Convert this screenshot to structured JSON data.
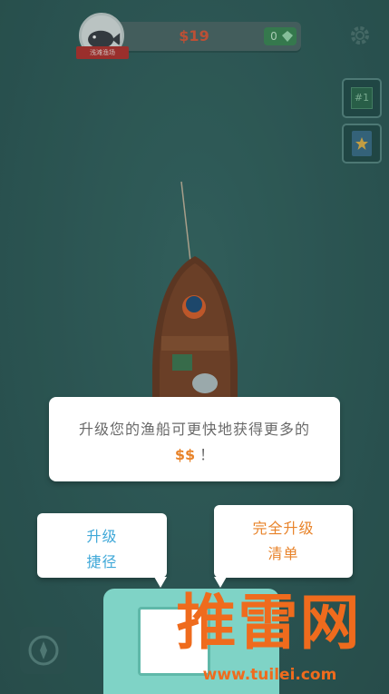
{
  "hud": {
    "money": "$19",
    "gems": "0",
    "rank_label": "浅滩渔场",
    "gem_icon": "gem-icon",
    "settings_icon": "gear-icon"
  },
  "side_buttons": [
    {
      "name": "rank-button",
      "label": "#1"
    },
    {
      "name": "collection-button",
      "label": ""
    }
  ],
  "dialog": {
    "line1": "升级您的渔船可更快地获得更多的",
    "dollars": "$$",
    "line2_suffix": "！"
  },
  "tips": {
    "shortcut_line1": "升级",
    "shortcut_line2": "捷径",
    "full_list_line1": "完全升级",
    "full_list_line2": "清单"
  },
  "watermark": {
    "logo_text": "推雷网",
    "url": "www.tuilei.com"
  },
  "colors": {
    "sea": "#2f5f5c",
    "money": "#e0593a",
    "accent_orange": "#e8832a",
    "accent_blue": "#3fa8d8",
    "upgrade_button": "#7fd3c6"
  }
}
